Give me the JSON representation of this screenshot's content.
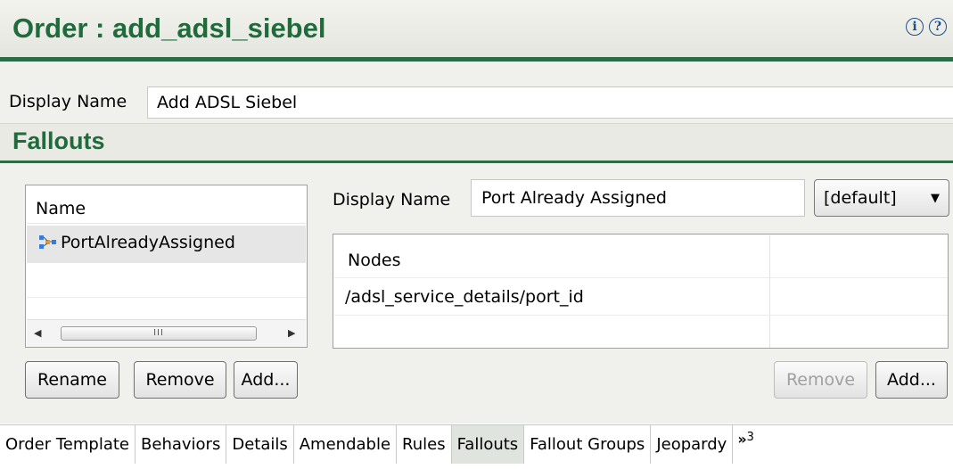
{
  "header": {
    "title": "Order : add_adsl_siebel",
    "info_glyph": "i",
    "help_glyph": "?"
  },
  "form": {
    "display_name_label": "Display Name",
    "display_name_value": "Add ADSL Siebel"
  },
  "fallouts": {
    "section_title": "Fallouts",
    "list": {
      "header": "Name",
      "items": [
        {
          "label": "PortAlreadyAssigned",
          "icon": "fallout-tree-icon",
          "selected": true
        }
      ],
      "scroll_thumb": "III"
    },
    "buttons": {
      "rename": "Rename",
      "remove": "Remove",
      "add": "Add..."
    },
    "detail": {
      "display_name_label": "Display Name",
      "display_name_value": "Port Already Assigned",
      "locale_select": "[default]",
      "nodes_header": "Nodes",
      "nodes": [
        "/adsl_service_details/port_id"
      ],
      "remove_button": "Remove",
      "add_button": "Add..."
    }
  },
  "tabs": {
    "items": [
      "Order Template",
      "Behaviors",
      "Details",
      "Amendable",
      "Rules",
      "Fallouts",
      "Fallout Groups",
      "Jeopardy"
    ],
    "active": "Fallouts",
    "overflow_symbol": "»",
    "overflow_count": "3"
  },
  "colors": {
    "title_green": "#1f6b3c",
    "rule_green": "#2b6b45",
    "form_bg": "#f0f0ec",
    "active_tab": "#dfe4de"
  }
}
